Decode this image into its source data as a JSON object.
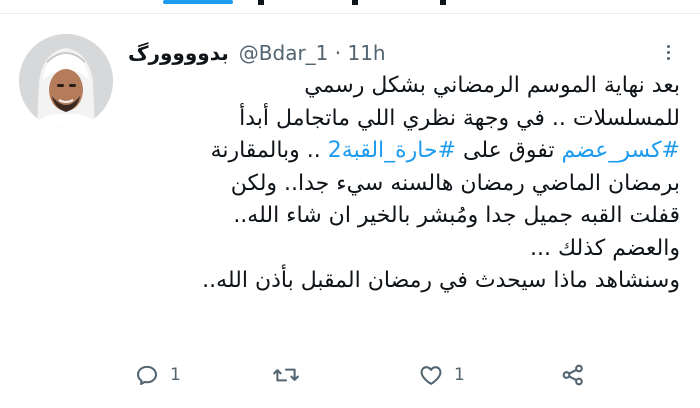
{
  "tweet": {
    "author": {
      "display_name": "بدوووورگ",
      "handle": "@Bdar_1",
      "time": "11h"
    },
    "body_lines": [
      [
        {
          "t": "بعد نهاية الموسم الرمضاني بشكل رسمي"
        }
      ],
      [
        {
          "t": "للمسلسلات .. في وجهة نظري اللي ماتجامل أبدأ"
        }
      ],
      [
        {
          "t": "#كسر_عضم",
          "tag": true
        },
        {
          "t": " تفوق على "
        },
        {
          "t": "#حارة_القبة2",
          "tag": true
        },
        {
          "t": " .. وبالمقارنة"
        }
      ],
      [
        {
          "t": "برمضان الماضي رمضان هالسنه سيء جدا.. ولكن"
        }
      ],
      [
        {
          "t": "قفلت القبه جميل جدا ومُبشر بالخير ان شاء الله.."
        }
      ],
      [
        {
          "t": "والعضم كذلك ..."
        }
      ],
      [
        {
          "t": "وسنشاهد ماذا سيحدث في رمضان المقبل بأذن الله.."
        }
      ]
    ],
    "actions": {
      "reply_count": "1",
      "retweet_count": "",
      "like_count": "1"
    }
  },
  "colors": {
    "accent": "#1d9bf0",
    "text": "#0f1419",
    "muted": "#536471"
  },
  "icons": [
    "more-icon",
    "reply-icon",
    "retweet-icon",
    "like-icon",
    "share-icon"
  ]
}
